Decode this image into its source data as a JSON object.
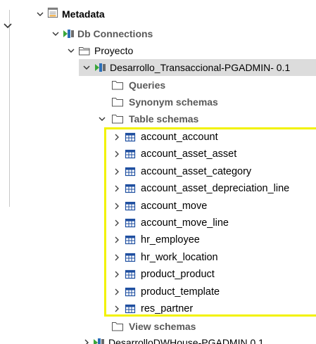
{
  "tree": {
    "metadata": {
      "label": "Metadata",
      "icon": "metadata-folder-icon"
    },
    "db_connections": {
      "label": "Db Connections",
      "icon": "db-connection-icon"
    },
    "proyecto": {
      "label": "Proyecto",
      "icon": "folder-open-icon"
    },
    "connection": {
      "label": "Desarrollo_Transaccional-PGADMIN- 0.1",
      "icon": "db-connection-icon"
    },
    "queries": {
      "label": "Queries",
      "icon": "folder-icon"
    },
    "synonym_schemas": {
      "label": "Synonym schemas",
      "icon": "folder-icon"
    },
    "table_schemas": {
      "label": "Table schemas",
      "icon": "folder-icon"
    },
    "tables": [
      {
        "label": "account_account"
      },
      {
        "label": "account_asset_asset"
      },
      {
        "label": "account_asset_category"
      },
      {
        "label": "account_asset_depreciation_line"
      },
      {
        "label": "account_move"
      },
      {
        "label": "account_move_line"
      },
      {
        "label": "hr_employee"
      },
      {
        "label": "hr_work_location"
      },
      {
        "label": "product_product"
      },
      {
        "label": "product_template"
      },
      {
        "label": "res_partner"
      }
    ],
    "view_schemas": {
      "label": "View schemas",
      "icon": "folder-icon"
    },
    "next_connection": {
      "label": "DesarrolloDWHouse-PGADMIN 0.1",
      "icon": "db-connection-icon"
    }
  },
  "colors": {
    "selection": "#dcdcdc",
    "highlight_border": "#f2f200",
    "table_icon": "#1f4fa0",
    "connection_icon_green": "#3aa63a"
  }
}
